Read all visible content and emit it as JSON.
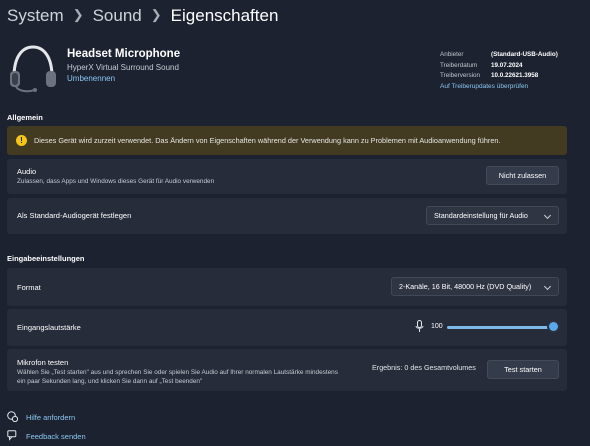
{
  "breadcrumb": {
    "item1": "System",
    "item2": "Sound",
    "current": "Eigenschaften"
  },
  "device": {
    "name": "Headset Microphone",
    "subtitle": "HyperX Virtual Surround Sound",
    "rename_link": "Umbenennen"
  },
  "driver_info": {
    "provider_label": "Anbieter",
    "provider_value": "(Standard-USB-Audio)",
    "date_label": "Treiberdatum",
    "date_value": "19.07.2024",
    "version_label": "Treiberversion",
    "version_value": "10.0.22621.3958",
    "update_link": "Auf Treiberupdates überprüfen"
  },
  "general": {
    "heading": "Allgemein",
    "warning": "Dieses Gerät wird zurzeit verwendet. Das Ändern von Eigenschaften während der Verwendung kann zu Problemen mit Audioanwendung führen.",
    "audio_label": "Audio",
    "audio_desc": "Zulassen, dass Apps und Windows dieses Gerät für Audio verwenden",
    "audio_button": "Nicht zulassen",
    "default_label": "Als Standard-Audiogerät festlegen",
    "default_value": "Standardeinstellung für Audio"
  },
  "input_settings": {
    "heading": "Eingabeeinstellungen",
    "format_label": "Format",
    "format_value": "2-Kanäle, 16 Bit, 48000 Hz (DVD Quality)",
    "volume_label": "Eingangslautstärke",
    "volume_value": "100",
    "test_label": "Mikrofon testen",
    "test_desc_line1": "Wählen Sie „Test starten\" aus und sprechen Sie oder spielen Sie Audio auf Ihrer normalen Lautstärke mindestens",
    "test_desc_line2": "ein paar Sekunden lang, und klicken Sie dann auf „Test beenden\"",
    "test_result": "Ergebnis: 0 des Gesamtvolumes",
    "test_button": "Test starten"
  },
  "footer": {
    "help": "Hilfe anfordern",
    "feedback": "Feedback senden"
  },
  "colors": {
    "accent": "#5aa9ec",
    "link": "#8cc7f2",
    "background": "#1c2230",
    "card": "#262c3a",
    "warning_bg": "#433b21",
    "warning_icon": "#f5c518"
  },
  "icons": {
    "device": "headset-icon",
    "warning": "warning-icon",
    "mic": "microphone-icon",
    "help": "help-icon",
    "feedback": "feedback-icon"
  }
}
